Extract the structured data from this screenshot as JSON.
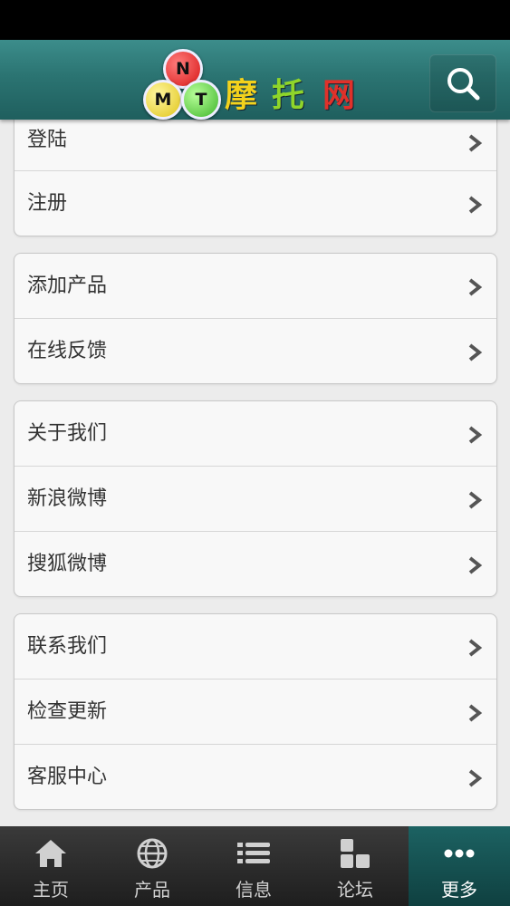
{
  "header": {
    "logo_letters": [
      "N",
      "M",
      "T"
    ],
    "logo_text": [
      "摩",
      "托",
      "网"
    ]
  },
  "menu_groups": [
    {
      "items": [
        {
          "label": "登陆"
        },
        {
          "label": "注册"
        }
      ]
    },
    {
      "items": [
        {
          "label": "添加产品"
        },
        {
          "label": "在线反馈"
        }
      ]
    },
    {
      "items": [
        {
          "label": "关于我们"
        },
        {
          "label": "新浪微博"
        },
        {
          "label": "搜狐微博"
        }
      ]
    },
    {
      "items": [
        {
          "label": "联系我们"
        },
        {
          "label": "检查更新"
        },
        {
          "label": "客服中心"
        }
      ]
    }
  ],
  "tabs": [
    {
      "label": "主页",
      "icon": "home-icon"
    },
    {
      "label": "产品",
      "icon": "globe-icon"
    },
    {
      "label": "信息",
      "icon": "list-icon"
    },
    {
      "label": "论坛",
      "icon": "blocks-icon"
    },
    {
      "label": "更多",
      "icon": "more-icon",
      "active": true
    }
  ],
  "colors": {
    "header": "#2b7472",
    "active_tab": "#1c6262",
    "background": "#ececec"
  }
}
